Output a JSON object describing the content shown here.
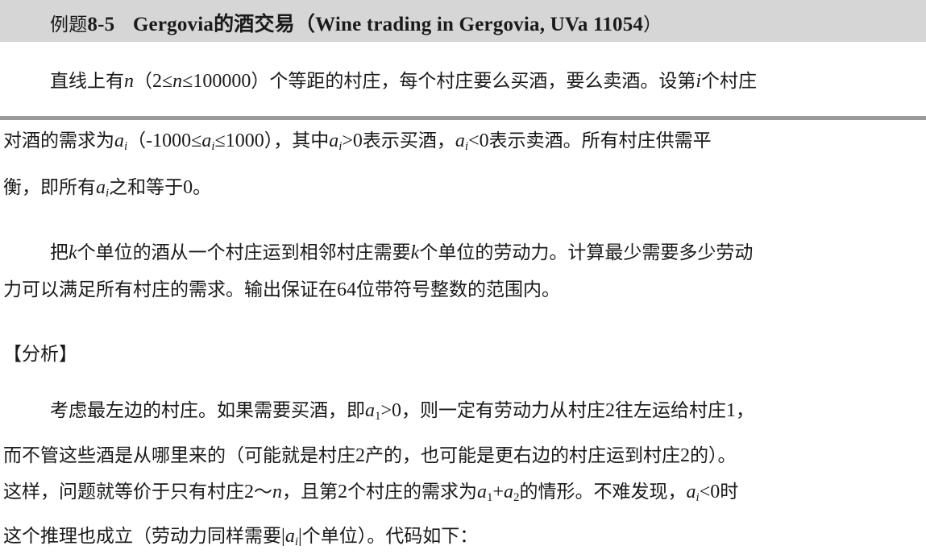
{
  "title": {
    "label": "例题",
    "number": "8-5",
    "name_cn": "Gergovia的酒交易（",
    "name_en": "Wine trading in Gergovia, UVa 11054",
    "close": "）"
  },
  "p1": {
    "a": "直线上有",
    "n": "n",
    "b": "（",
    "range_lo": "2≤",
    "n2": "n",
    "range_hi": "≤100000",
    "c": "）个等距的村庄，每个村庄要么买酒，要么卖酒。设第",
    "i": "i",
    "d": "个村庄"
  },
  "p2": {
    "a": "对酒的需求为",
    "ai": "a",
    "i": "i",
    "b": "（",
    "lo": "-1000≤",
    "ai2": "a",
    "i2": "i",
    "hi": "≤1000",
    "c": "），其中",
    "ai3": "a",
    "i3": "i",
    "gt": ">0",
    "d": "表示买酒，",
    "ai4": "a",
    "i4": "i",
    "lt": "<0",
    "e": "表示卖酒。所有村庄供需平",
    "f": "衡，即所有",
    "ai5": "a",
    "i5": "i",
    "g": "之和等于",
    "zero": "0",
    "h": "。"
  },
  "p3": {
    "a": "把",
    "k": "k",
    "b": "个单位的酒从一个村庄运到相邻村庄需要",
    "k2": "k",
    "c": "个单位的劳动力。计算最少需要多少劳动",
    "d": "力可以满足所有村庄的需求。输出保证在",
    "n64": "64",
    "e": "位带符号整数的范围内。"
  },
  "section": "【分析】",
  "p4": {
    "a": "考虑最左边的村庄。如果需要买酒，即",
    "a1": "a",
    "s1": "1",
    "gt": ">0",
    "b": "，则一定有劳动力从村庄",
    "v2": "2",
    "c": "往左运给村庄",
    "v1": "1",
    "d": "，",
    "e": "而不管这些酒是从哪里来的（可能就是村庄",
    "v2b": "2",
    "f": "产的，也可能是更右边的村庄运到村庄",
    "v2c": "2",
    "g": "的）。",
    "h": "这样，问题就等价于只有村庄",
    "v2d": "2",
    "tilde": "～",
    "n": "n",
    "j": "，且第",
    "v2e": "2",
    "k": "个村庄的需求为",
    "a1b": "a",
    "s1b": "1",
    "plus": "+",
    "a2": "a",
    "s2": "2",
    "l": "的情形。不难发现，",
    "ai": "a",
    "si": "i",
    "lt": "<0",
    "m": "时",
    "o": "这个推理也成立（劳动力同样需要",
    "abs_open": "|",
    "ai2": "a",
    "si2": "i",
    "abs_close": "|",
    "p": "个单位）。代码如下："
  }
}
